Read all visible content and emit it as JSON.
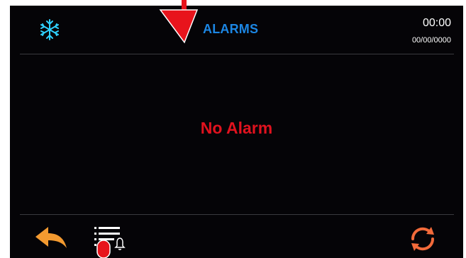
{
  "header": {
    "title": "ALARMS",
    "mode_icon": "snowflake-icon",
    "time": "00:00",
    "date": "00/00/0000"
  },
  "main": {
    "message": "No Alarm"
  },
  "footer": {
    "back_icon": "back-arrow-icon",
    "alarm_list_icon": "alarm-list-icon",
    "refresh_icon": "refresh-icon"
  },
  "colors": {
    "screen_bg": "#050407",
    "accent_blue": "#1c86e3",
    "snowflake": "#2fd0ff",
    "alarm_red": "#e0121e",
    "back_orange": "#f39a30",
    "refresh_orange": "#f26a3a",
    "annotation_red": "#e8141c"
  }
}
